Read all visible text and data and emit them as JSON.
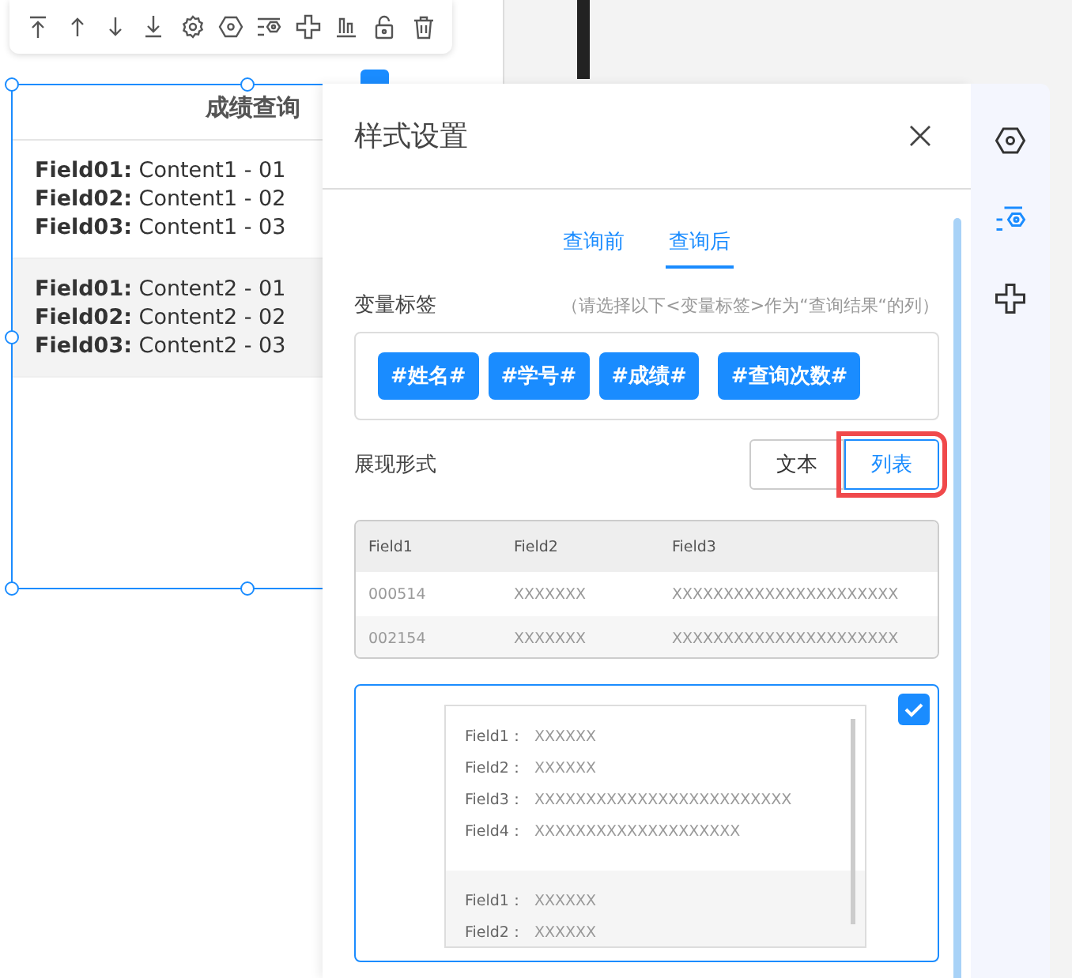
{
  "widget": {
    "title": "成绩查询",
    "records": [
      {
        "fields": [
          {
            "label": "Field01:",
            "value": "Content1 - 01"
          },
          {
            "label": "Field02:",
            "value": "Content1 - 02"
          },
          {
            "label": "Field03:",
            "value": "Content1 - 03"
          }
        ]
      },
      {
        "fields": [
          {
            "label": "Field01:",
            "value": "Content2 - 01"
          },
          {
            "label": "Field02:",
            "value": "Content2 - 02"
          },
          {
            "label": "Field03:",
            "value": "Content2 - 03"
          }
        ]
      }
    ]
  },
  "panel": {
    "title": "样式设置",
    "tabs": [
      {
        "label": "查询前",
        "selected": false
      },
      {
        "label": "查询后",
        "selected": true
      }
    ],
    "variable_tags": {
      "label": "变量标签",
      "hint": "（请选择以下<变量标签>作为“查询结果“的列）",
      "tags": [
        "#姓名#",
        "#学号#",
        "#成绩#",
        "#查询次数#"
      ]
    },
    "display_form": {
      "label": "展现形式",
      "options": [
        {
          "label": "文本",
          "selected": false,
          "highlighted": false
        },
        {
          "label": "列表",
          "selected": true,
          "highlighted": true
        }
      ]
    },
    "preview_styles": [
      {
        "kind": "table",
        "selected": false,
        "columns": [
          "Field1",
          "Field2",
          "Field3"
        ],
        "rows": [
          [
            "000514",
            "XXXXXXX",
            "XXXXXXXXXXXXXXXXXXXXXX"
          ],
          [
            "002154",
            "XXXXXXX",
            "XXXXXXXXXXXXXXXXXXXXXX"
          ]
        ]
      },
      {
        "kind": "list",
        "selected": true,
        "records": [
          [
            {
              "label": "Field1：",
              "value": "XXXXXX"
            },
            {
              "label": "Field2：",
              "value": "XXXXXX"
            },
            {
              "label": "Field3：",
              "value": "XXXXXXXXXXXXXXXXXXXXXXXXX"
            },
            {
              "label": "Field4：",
              "value": "XXXXXXXXXXXXXXXXXXXX"
            }
          ],
          [
            {
              "label": "Field1：",
              "value": "XXXXXX"
            },
            {
              "label": "Field2：",
              "value": "XXXXXX"
            }
          ]
        ]
      }
    ]
  },
  "side_tabs": [
    {
      "selected": false
    },
    {
      "selected": true
    },
    {
      "selected": false
    }
  ]
}
